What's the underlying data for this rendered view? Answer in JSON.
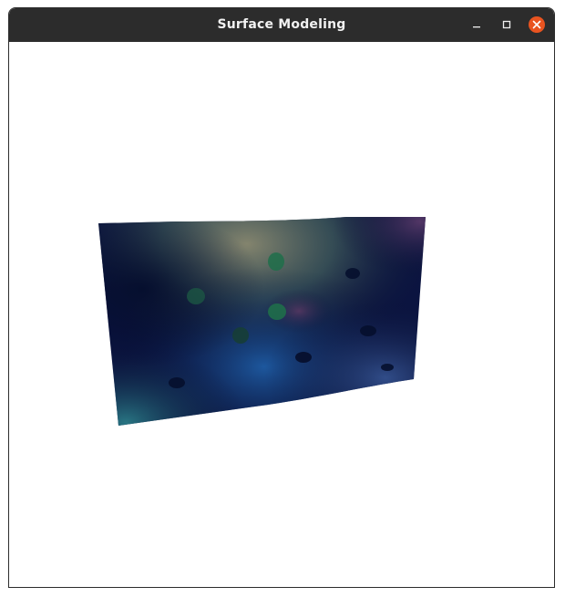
{
  "window": {
    "title": "Surface Modeling"
  },
  "window_controls": {
    "minimize": "minimize-icon",
    "maximize": "maximize-icon",
    "close": "close-icon",
    "close_color": "#e95420"
  },
  "scene": {
    "object": "3D shaded surface",
    "background_color": "#ffffff",
    "surface_colors": [
      "#0a0f3a",
      "#1f5a6e",
      "#7a7f6a",
      "#3a2a5a",
      "#1a4fa0"
    ],
    "control_point_colors": [
      "#1f6e4a",
      "#0a1a4a"
    ]
  }
}
